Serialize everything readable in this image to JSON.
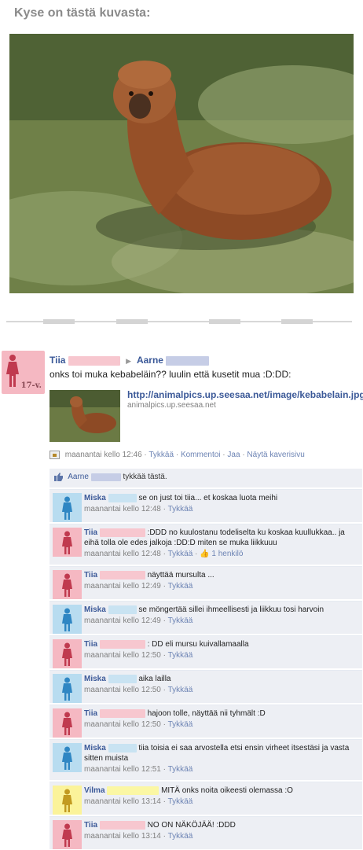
{
  "heading": "Kyse on tästä kuvasta:",
  "post": {
    "author": "Tiia",
    "recipient": "Aarne",
    "age": "17-v.",
    "text": "onks toi muka kebabeläin?? luulin että kusetit mua :D:DD:",
    "link_url": "http://animalpics.up.seesaa.net/image/kebabelain.jpg",
    "link_domain": "animalpics.up.seesaa.net",
    "meta_time": "maanantai kello 12:46",
    "actions": [
      "Tykkää",
      "Kommentoi",
      "Jaa",
      "Näytä kaverisivu"
    ]
  },
  "likes": {
    "name": "Aarne",
    "suffix": "tykkää tästä."
  },
  "comments": [
    {
      "author": "Miska",
      "color": "lblue",
      "text": "se on just toi tiia... et koskaa luota meihi",
      "time": "maanantai kello 12:48",
      "like": "Tykkää"
    },
    {
      "author": "Tiia",
      "color": "pink",
      "text": ":DDD no kuulostanu todeliselta ku koskaa kuullukkaa.. ja eihä tolla ole edes jalkoja :DD:D miten se muka liikkuuu",
      "time": "maanantai kello 12:48",
      "like": "Tykkää",
      "likes_count": "1 henkilö"
    },
    {
      "author": "Tiia",
      "color": "pink",
      "text": "näyttää mursulta ...",
      "time": "maanantai kello 12:49",
      "like": "Tykkää"
    },
    {
      "author": "Miska",
      "color": "lblue",
      "text": "se möngertää sillei ihmeellisesti ja liikkuu tosi harvoin",
      "time": "maanantai kello 12:49",
      "like": "Tykkää"
    },
    {
      "author": "Tiia",
      "color": "pink",
      "text": ": DD eli mursu kuivallamaalla",
      "time": "maanantai kello 12:50",
      "like": "Tykkää"
    },
    {
      "author": "Miska",
      "color": "lblue",
      "text": "aika lailla",
      "time": "maanantai kello 12:50",
      "like": "Tykkää"
    },
    {
      "author": "Tiia",
      "color": "pink",
      "text": "hajoon tolle, näyttää nii tyhmält :D",
      "time": "maanantai kello 12:50",
      "like": "Tykkää"
    },
    {
      "author": "Miska",
      "color": "lblue",
      "text": "tiia toisia ei saa arvostella etsi ensin virheet itsestäsi ja vasta sitten muista",
      "time": "maanantai kello 12:51",
      "like": "Tykkää"
    },
    {
      "author": "Vilma",
      "color": "yellow",
      "text": "MITÄ onks noita oikeesti olemassa :O",
      "time": "maanantai kello 13:14",
      "like": "Tykkää"
    },
    {
      "author": "Tiia",
      "color": "pink",
      "text": "NO ON NÄKÖJÄÄ! :DDD",
      "time": "maanantai kello 13:14",
      "like": "Tykkää"
    }
  ],
  "icons": {
    "person": "person-icon",
    "like": "thumbs-up-icon",
    "feed": "feed-story-icon"
  }
}
